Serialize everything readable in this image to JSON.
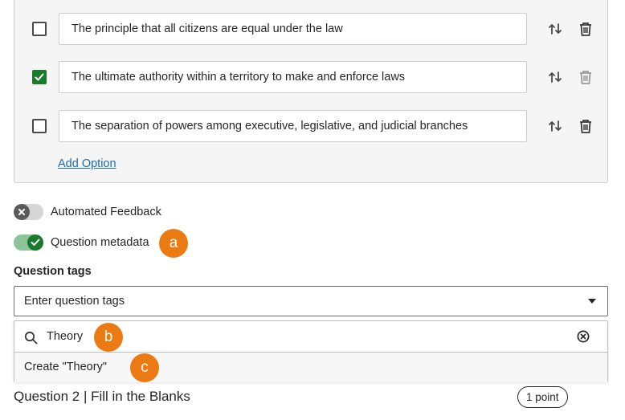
{
  "options": [
    {
      "text": "The principle that all citizens are equal under the law",
      "checked": false
    },
    {
      "text": "The ultimate authority within a territory to make and enforce laws",
      "checked": true
    },
    {
      "text": "The separation of powers among executive, legislative, and judicial branches",
      "checked": false
    }
  ],
  "add_option_label": "Add Option",
  "toggles": {
    "automated_feedback": {
      "label": "Automated Feedback",
      "on": false
    },
    "question_metadata": {
      "label": "Question metadata",
      "on": true
    }
  },
  "question_tags": {
    "label": "Question tags",
    "placeholder": "Enter question tags",
    "search_value": "Theory",
    "create_item": "Create \"Theory\""
  },
  "callouts": {
    "a": "a",
    "b": "b",
    "c": "c"
  },
  "next_question": {
    "title": "Question 2 | Fill in the Blanks",
    "points": "1 point"
  },
  "colors": {
    "accent_green": "#1a7a2b",
    "link_blue": "#1e6ba8",
    "callout_orange": "#ec7a12"
  }
}
